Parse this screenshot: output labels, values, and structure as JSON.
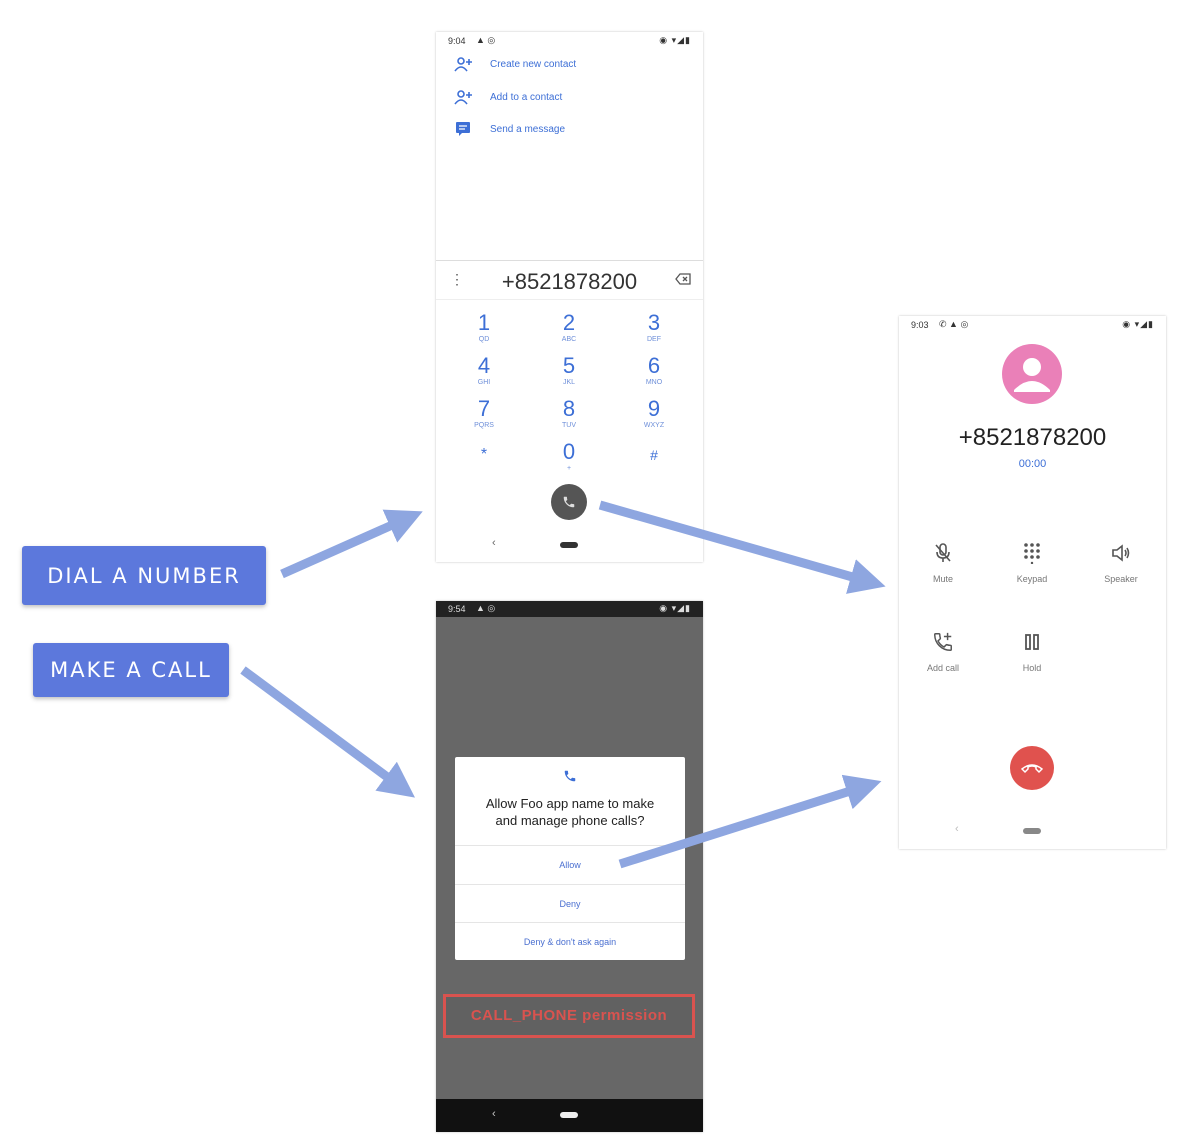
{
  "buttons": {
    "dial": "DIAL A NUMBER",
    "call": "MAKE A CALL"
  },
  "dialer": {
    "time": "9:04",
    "menu": [
      {
        "label": "Create new contact",
        "icon": "add-person-icon"
      },
      {
        "label": "Add to a contact",
        "icon": "add-person-icon"
      },
      {
        "label": "Send a message",
        "icon": "message-icon"
      }
    ],
    "number": "+8521878200",
    "keys": [
      {
        "digit": "1",
        "letters": "QD"
      },
      {
        "digit": "2",
        "letters": "ABC"
      },
      {
        "digit": "3",
        "letters": "DEF"
      },
      {
        "digit": "4",
        "letters": "GHI"
      },
      {
        "digit": "5",
        "letters": "JKL"
      },
      {
        "digit": "6",
        "letters": "MNO"
      },
      {
        "digit": "7",
        "letters": "PQRS"
      },
      {
        "digit": "8",
        "letters": "TUV"
      },
      {
        "digit": "9",
        "letters": "WXYZ"
      },
      {
        "digit": "*",
        "letters": ""
      },
      {
        "digit": "0",
        "letters": "+"
      },
      {
        "digit": "#",
        "letters": ""
      }
    ],
    "nav_back": "‹"
  },
  "permission": {
    "time": "9:54",
    "title": "Allow Foo app name to make and manage phone calls?",
    "options": [
      "Allow",
      "Deny",
      "Deny & don't ask again"
    ],
    "label": "CALL_PHONE permission",
    "nav_back": "‹"
  },
  "incall": {
    "time": "9:03",
    "number": "+8521878200",
    "duration": "00:00",
    "controls": [
      {
        "label": "Mute",
        "icon": "mute-icon"
      },
      {
        "label": "Keypad",
        "icon": "keypad-icon"
      },
      {
        "label": "Speaker",
        "icon": "speaker-icon"
      },
      {
        "label": "Add call",
        "icon": "add-call-icon"
      },
      {
        "label": "Hold",
        "icon": "hold-icon"
      }
    ],
    "nav_back": "‹"
  },
  "colors": {
    "button": "#5c78dc",
    "arrow": "#8ea6e0",
    "accent": "#3d6fd6",
    "hangup": "#e0524e",
    "avatar": "#ea80b8",
    "permission_box": "#d9534f",
    "scrim": "#676767"
  }
}
